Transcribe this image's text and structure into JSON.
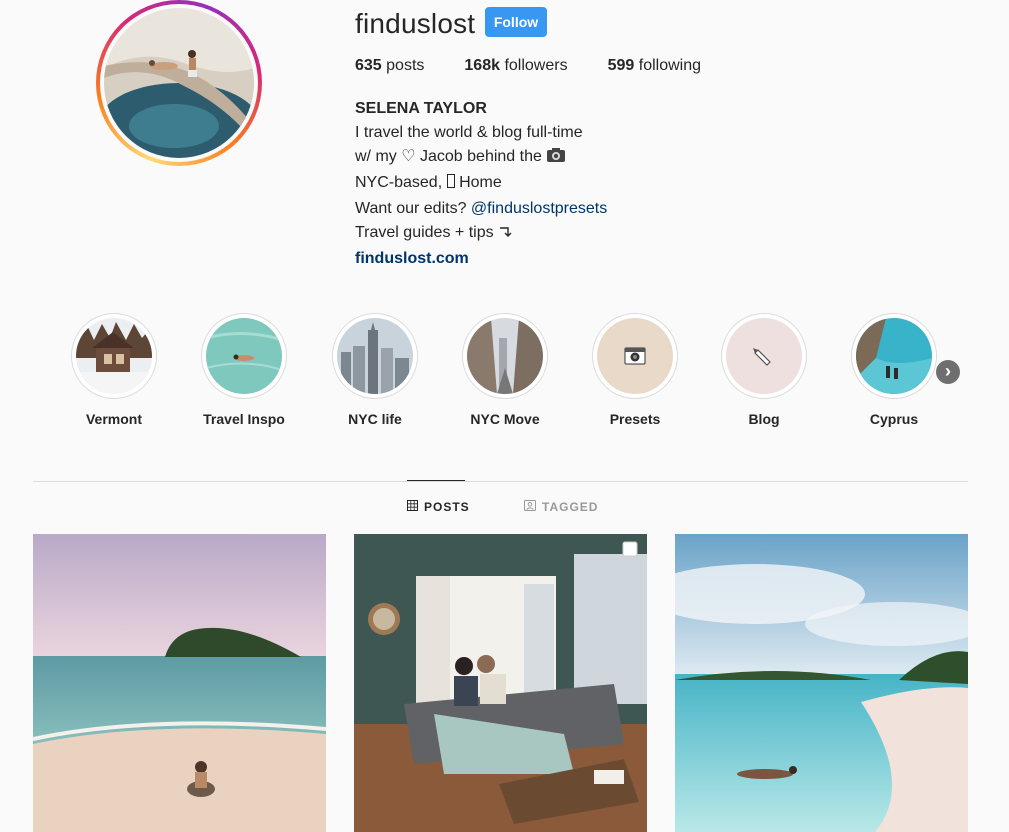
{
  "profile": {
    "username": "finduslost",
    "follow_label": "Follow",
    "stats": {
      "posts_count": "635",
      "posts_label": "posts",
      "followers_count": "168k",
      "followers_label": "followers",
      "following_count": "599",
      "following_label": "following"
    },
    "bio": {
      "name": "SELENA TAYLOR",
      "line1": "I travel the world & blog full-time",
      "line2": "w/ my ♡ Jacob behind the",
      "line3_a": "NYC-based,",
      "line3_b": "Home",
      "line4": "Want our edits?",
      "mention": "@finduslostpresets",
      "line5": "Travel guides + tips",
      "website": "finduslost.com"
    }
  },
  "highlights": [
    {
      "label": "Vermont",
      "icon": "cabin-photo"
    },
    {
      "label": "Travel Inspo",
      "icon": "swimmer-photo"
    },
    {
      "label": "NYC life",
      "icon": "skyline-photo"
    },
    {
      "label": "NYC Move",
      "icon": "street-photo"
    },
    {
      "label": "Presets",
      "icon": "camera-icon"
    },
    {
      "label": "Blog",
      "icon": "pencil-icon"
    },
    {
      "label": "Cyprus",
      "icon": "beach-photo"
    }
  ],
  "tabs": {
    "posts": "POSTS",
    "tagged": "TAGGED"
  },
  "posts": [
    {
      "scene": "island-beach"
    },
    {
      "scene": "living-room"
    },
    {
      "scene": "lagoon"
    }
  ],
  "colors": {
    "follow_button": "#3897f0",
    "link": "#003569",
    "background": "#fafafa",
    "divider": "#dbdbdb"
  }
}
